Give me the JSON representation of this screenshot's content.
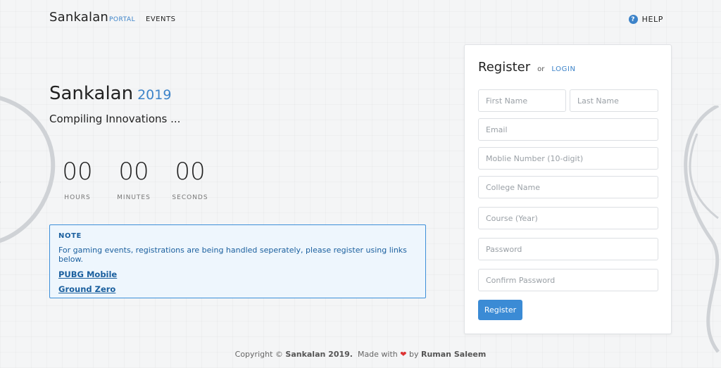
{
  "nav": {
    "brand": "Sankalan",
    "brand_sub": "PORTAL",
    "events": "EVENTS",
    "help": "HELP",
    "help_icon": "?"
  },
  "hero": {
    "title": "Sankalan",
    "year": "2019",
    "tagline": "Compiling Innovations ..."
  },
  "countdown": [
    {
      "value": "00",
      "label": "HOURS"
    },
    {
      "value": "00",
      "label": "MINUTES"
    },
    {
      "value": "00",
      "label": "SECONDS"
    }
  ],
  "note": {
    "title": "NOTE",
    "text": "For gaming events, registrations are being handled seperately, please register using links below.",
    "links": [
      "PUBG Mobile",
      "Ground Zero"
    ]
  },
  "register": {
    "title": "Register",
    "or": "or",
    "login": "LOGIN",
    "fields": {
      "first_name": "First Name",
      "last_name": "Last Name",
      "email": "Email",
      "mobile": "Moblie Number (10-digit)",
      "college": "College Name",
      "course": "Course (Year)",
      "password": "Password",
      "confirm_password": "Confirm Password"
    },
    "submit": "Register"
  },
  "footer": {
    "copyright": "Copyright ©",
    "site": "Sankalan 2019.",
    "made_with": "Made with",
    "heart": "❤",
    "by": "by",
    "author": "Ruman Saleem"
  },
  "colors": {
    "accent": "#3c83c9",
    "button": "#3b8bd5",
    "note_border": "#3c8fd9",
    "note_bg": "#eef6fd",
    "heart": "#dd3333"
  }
}
